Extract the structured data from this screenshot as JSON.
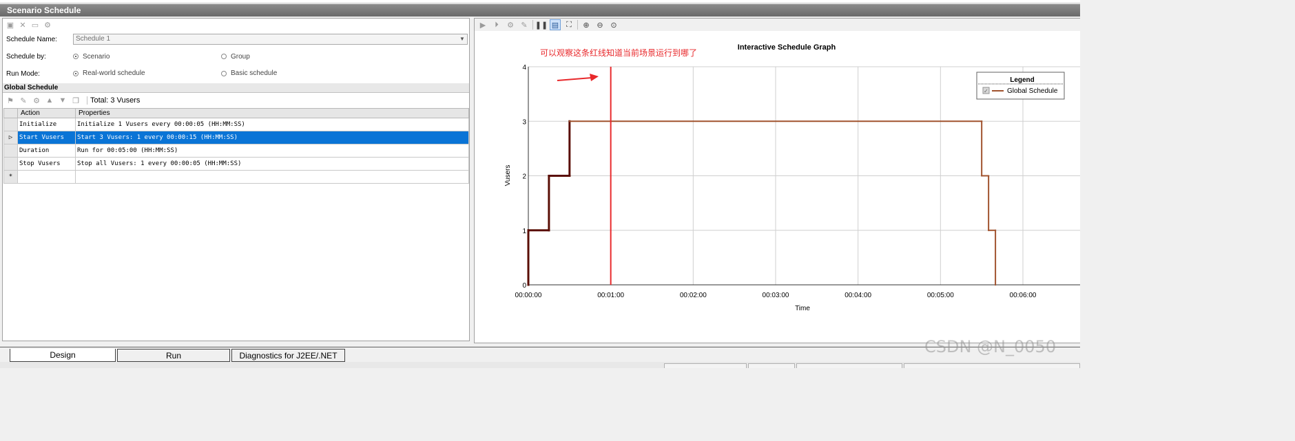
{
  "window": {
    "title": "Scenario Schedule"
  },
  "schedule_form": {
    "name_label": "Schedule Name:",
    "name_value": "Schedule 1",
    "schedule_by_label": "Schedule by:",
    "schedule_by_options": [
      "Scenario",
      "Group"
    ],
    "schedule_by_selected": "Scenario",
    "run_mode_label": "Run Mode:",
    "run_mode_options": [
      "Real-world schedule",
      "Basic schedule"
    ],
    "run_mode_selected": "Real-world schedule"
  },
  "global_schedule": {
    "header": "Global Schedule",
    "total": "Total: 3 Vusers",
    "columns": [
      "Action",
      "Properties"
    ],
    "rows": [
      {
        "action": "Initialize",
        "properties": "Initialize 1 Vusers every 00:00:05 (HH:MM:SS)"
      },
      {
        "action": "Start  Vusers",
        "properties": "Start 3 Vusers: 1 every 00:00:15 (HH:MM:SS)"
      },
      {
        "action": "Duration",
        "properties": "Run for 00:05:00 (HH:MM:SS)"
      },
      {
        "action": "Stop Vusers",
        "properties": "Stop all Vusers: 1 every 00:00:05 (HH:MM:SS)"
      }
    ],
    "selected_row": 1,
    "new_row_marker": "*",
    "current_row_marker": "▷"
  },
  "tabs": [
    {
      "label": "Design",
      "active": true
    },
    {
      "label": "Run",
      "active": false
    },
    {
      "label": "Diagnostics for J2EE/.NET",
      "active": false
    }
  ],
  "annotation": {
    "text": "可以观察这条红线知道当前场景运行到哪了",
    "color": "#e8282b"
  },
  "watermark": "CSDN @N_0050",
  "chart_data": {
    "type": "line",
    "title": "Interactive Schedule Graph",
    "xlabel": "Time",
    "ylabel": "Vusers",
    "x_unit": "seconds",
    "xlim": [
      0,
      360
    ],
    "ylim": [
      0,
      4
    ],
    "x_ticks": [
      0,
      60,
      120,
      180,
      240,
      300,
      360
    ],
    "x_tick_labels": [
      "00:00:00",
      "00:01:00",
      "00:02:00",
      "00:03:00",
      "00:04:00",
      "00:05:00",
      "00:06:00"
    ],
    "y_ticks": [
      0,
      1,
      2,
      3,
      4
    ],
    "grid": true,
    "legend_title": "Legend",
    "legend_position": "top-right",
    "series": [
      {
        "name": "Global Schedule",
        "color": "#a0522d",
        "ramp_color": "#5a0e05",
        "ramp_end_x": 30,
        "points": [
          [
            0,
            0
          ],
          [
            0,
            1
          ],
          [
            15,
            1
          ],
          [
            15,
            2
          ],
          [
            30,
            2
          ],
          [
            30,
            3
          ],
          [
            330,
            3
          ],
          [
            330,
            2
          ],
          [
            335,
            2
          ],
          [
            335,
            1
          ],
          [
            340,
            1
          ],
          [
            340,
            0
          ]
        ]
      }
    ],
    "current_time_marker": {
      "x": 60,
      "color": "#e8282b"
    }
  }
}
